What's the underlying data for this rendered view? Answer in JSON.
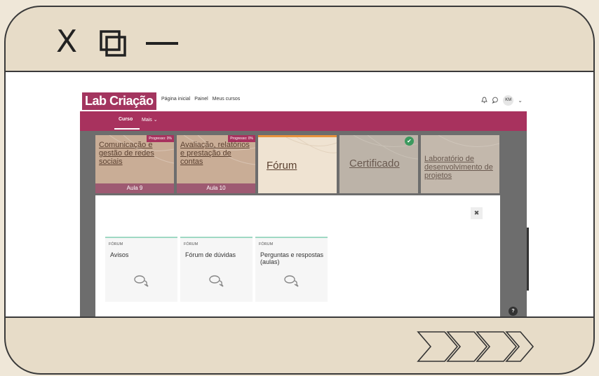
{
  "window_controls": {
    "close_glyph": "X",
    "maximize_icon": "restore-windows-icon",
    "minimize_icon": "minimize-line-icon"
  },
  "site": {
    "logo": "Lab Criação",
    "nav": [
      "Página inicial",
      "Painel",
      "Meus cursos"
    ],
    "user_initials": "KM",
    "icons": [
      "bell-icon",
      "chat-icon"
    ]
  },
  "secondary_nav": {
    "tabs": [
      "Curso",
      "Mais ⌄"
    ]
  },
  "course_cards": [
    {
      "title": "Comunicação e gestão de redes sociais",
      "progress": "Progresso: 0%",
      "footer": "Aula 9"
    },
    {
      "title": "Avaliação, relatórios e prestação de contas",
      "progress": "Progresso: 0%",
      "footer": "Aula 10"
    },
    {
      "title": "Fórum"
    },
    {
      "title": "Certificado"
    },
    {
      "title": "Laboratório de desenvolvimento de projetos"
    }
  ],
  "modal": {
    "close": "✖",
    "items": [
      {
        "type": "FÓRUM",
        "name": "Avisos"
      },
      {
        "type": "FÓRUM",
        "name": "Fórum de dúvidas"
      },
      {
        "type": "FÓRUM",
        "name": "Perguntas e respostas (aulas)"
      }
    ]
  },
  "help_button": "?",
  "colors": {
    "brand": "#a8325e",
    "accent": "#9fd9c3",
    "frame": "#e7dcc8"
  }
}
